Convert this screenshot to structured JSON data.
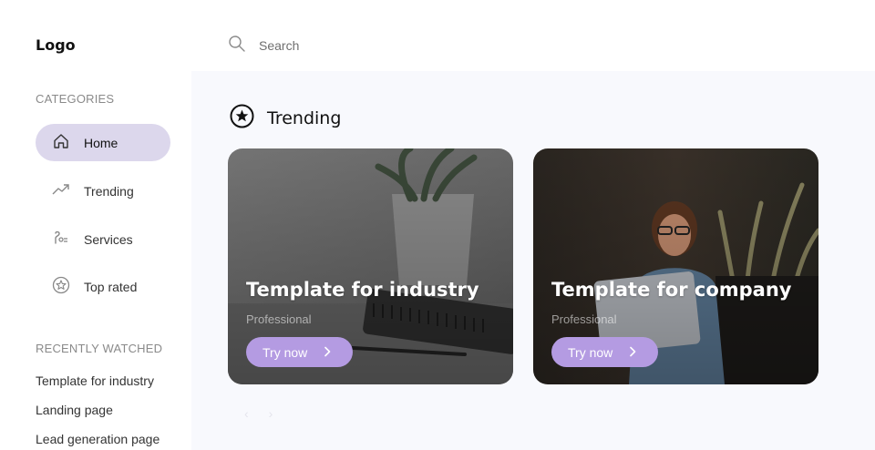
{
  "app": {
    "logo": "Logo"
  },
  "search": {
    "placeholder": "Search"
  },
  "sidebar": {
    "categories_label": "CATEGORIES",
    "items": [
      {
        "label": "Home",
        "icon": "home-icon",
        "active": true
      },
      {
        "label": "Trending",
        "icon": "trending-icon",
        "active": false
      },
      {
        "label": "Services",
        "icon": "services-icon",
        "active": false
      },
      {
        "label": "Top rated",
        "icon": "star-icon",
        "active": false
      }
    ],
    "recent_label": "RECENTLY WATCHED",
    "recent": [
      "Template for industry",
      "Landing page",
      "Lead generation page"
    ]
  },
  "main": {
    "section_title": "Trending",
    "section_icon": "star-circle-icon",
    "cards": [
      {
        "title": "Template for industry",
        "subtitle": "Professional",
        "button": "Try now"
      },
      {
        "title": "Template for company",
        "subtitle": "Professional",
        "button": "Try now"
      }
    ],
    "pager": {
      "prev": "‹",
      "next": "›"
    }
  },
  "colors": {
    "accent": "#b49be2",
    "active_nav": "#dcd7ec",
    "main_bg": "#f8f9fd"
  }
}
